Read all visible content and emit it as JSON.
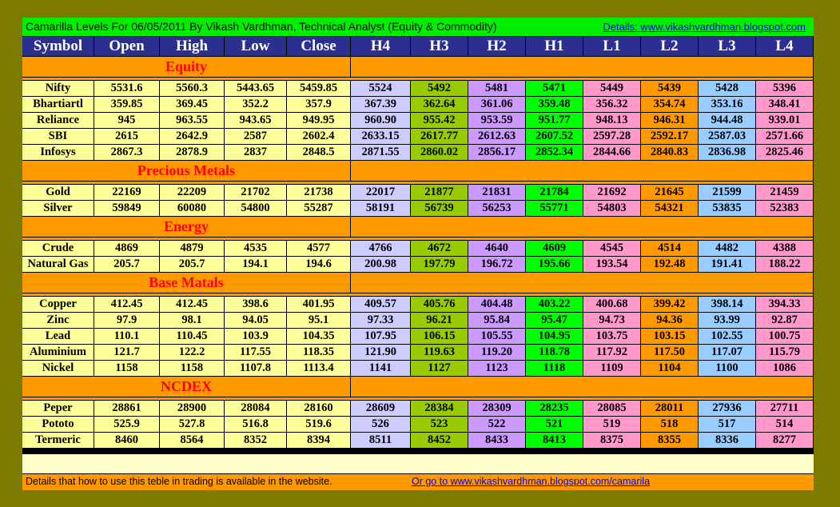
{
  "title": "Camarilla Levels For 06/05/2011 By Vikash Vardhman, Technical Analyst (Equity & Commodity)",
  "details_link": "Details: www.vikashvardhman.blogspot.com",
  "columns": [
    "Symbol",
    "Open",
    "High",
    "Low",
    "Close",
    "H4",
    "H3",
    "H2",
    "H1",
    "L1",
    "L2",
    "L3",
    "L4"
  ],
  "sections": [
    {
      "name": "Equity",
      "rows": [
        [
          "Nifty",
          "5531.6",
          "5560.3",
          "5443.65",
          "5459.85",
          "5524",
          "5492",
          "5481",
          "5471",
          "5449",
          "5439",
          "5428",
          "5396"
        ],
        [
          "Bhartiartl",
          "359.85",
          "369.45",
          "352.2",
          "357.9",
          "367.39",
          "362.64",
          "361.06",
          "359.48",
          "356.32",
          "354.74",
          "353.16",
          "348.41"
        ],
        [
          "Reliance",
          "945",
          "963.55",
          "943.65",
          "949.95",
          "960.90",
          "955.42",
          "953.59",
          "951.77",
          "948.13",
          "946.31",
          "944.48",
          "939.01"
        ],
        [
          "SBI",
          "2615",
          "2642.9",
          "2587",
          "2602.4",
          "2633.15",
          "2617.77",
          "2612.63",
          "2607.52",
          "2597.28",
          "2592.17",
          "2587.03",
          "2571.66"
        ],
        [
          "Infosys",
          "2867.3",
          "2878.9",
          "2837",
          "2848.5",
          "2871.55",
          "2860.02",
          "2856.17",
          "2852.34",
          "2844.66",
          "2840.83",
          "2836.98",
          "2825.46"
        ]
      ]
    },
    {
      "name": "Precious Metals",
      "rows": [
        [
          "Gold",
          "22169",
          "22209",
          "21702",
          "21738",
          "22017",
          "21877",
          "21831",
          "21784",
          "21692",
          "21645",
          "21599",
          "21459"
        ],
        [
          "Silver",
          "59849",
          "60080",
          "54800",
          "55287",
          "58191",
          "56739",
          "56253",
          "55771",
          "54803",
          "54321",
          "53835",
          "52383"
        ]
      ]
    },
    {
      "name": "Energy",
      "rows": [
        [
          "Crude",
          "4869",
          "4879",
          "4535",
          "4577",
          "4766",
          "4672",
          "4640",
          "4609",
          "4545",
          "4514",
          "4482",
          "4388"
        ],
        [
          "Natural Gas",
          "205.7",
          "205.7",
          "194.1",
          "194.6",
          "200.98",
          "197.79",
          "196.72",
          "195.66",
          "193.54",
          "192.48",
          "191.41",
          "188.22"
        ]
      ]
    },
    {
      "name": "Base Matals",
      "rows": [
        [
          "Copper",
          "412.45",
          "412.45",
          "398.6",
          "401.95",
          "409.57",
          "405.76",
          "404.48",
          "403.22",
          "400.68",
          "399.42",
          "398.14",
          "394.33"
        ],
        [
          "Zinc",
          "97.9",
          "98.1",
          "94.05",
          "95.1",
          "97.33",
          "96.21",
          "95.84",
          "95.47",
          "94.73",
          "94.36",
          "93.99",
          "92.87"
        ],
        [
          "Lead",
          "110.1",
          "110.45",
          "103.9",
          "104.35",
          "107.95",
          "106.15",
          "105.55",
          "104.95",
          "103.75",
          "103.15",
          "102.55",
          "100.75"
        ],
        [
          "Aluminium",
          "121.7",
          "122.2",
          "117.55",
          "118.35",
          "121.90",
          "119.63",
          "119.20",
          "118.78",
          "117.92",
          "117.50",
          "117.07",
          "115.79"
        ],
        [
          "Nickel",
          "1158",
          "1158",
          "1107.8",
          "1113.4",
          "1141",
          "1127",
          "1123",
          "1118",
          "1109",
          "1104",
          "1100",
          "1086"
        ]
      ]
    },
    {
      "name": "NCDEX",
      "rows": [
        [
          "Peper",
          "28861",
          "28900",
          "28084",
          "28160",
          "28609",
          "28384",
          "28309",
          "28235",
          "28085",
          "28011",
          "27936",
          "27711"
        ],
        [
          "Pototo",
          "525.9",
          "527.8",
          "516.8",
          "519.6",
          "526",
          "523",
          "522",
          "521",
          "519",
          "518",
          "517",
          "514"
        ],
        [
          "Termeric",
          "8460",
          "8564",
          "8352",
          "8394",
          "8511",
          "8452",
          "8433",
          "8413",
          "8375",
          "8355",
          "8336",
          "8277"
        ]
      ]
    }
  ],
  "footer": {
    "note": "Details that how to use this teble in trading is available in the website.",
    "link": "Or go to www.vikashvardhman.blogspot.com/camarila"
  },
  "colors": {
    "background": "#7d7a00",
    "title_bar": "#00ee00",
    "header": "#2b2f8f",
    "section": "#ff9900",
    "section_text": "#ff0000",
    "base_cells": "#ffff99",
    "H4": "#ccccff",
    "H3": "#99cc00",
    "H2": "#cc99ff",
    "H1": "#00ff00",
    "L1": "#ff99cc",
    "L2": "#ff9900",
    "L3": "#99ccff",
    "L4": "#ff99cc"
  }
}
